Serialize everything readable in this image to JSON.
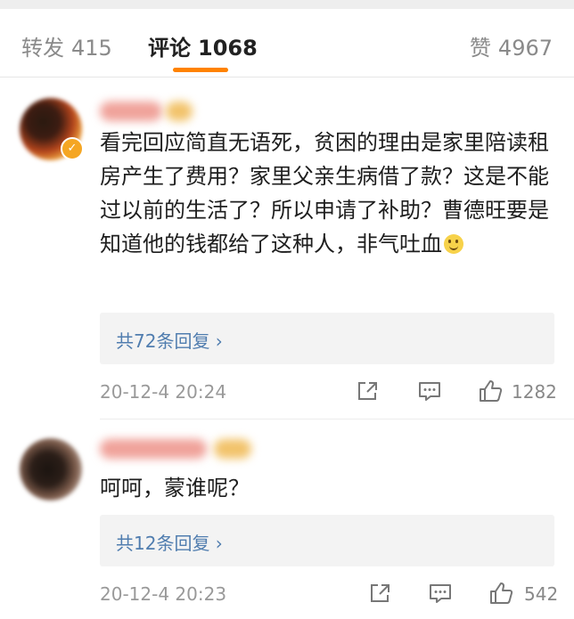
{
  "tabs": [
    {
      "label": "转发",
      "count": "415"
    },
    {
      "label": "评论",
      "count": "1068"
    },
    {
      "label": "赞",
      "count": "4967"
    }
  ],
  "comments": [
    {
      "text": "看完回应简直无语死，贫困的理由是家里陪读租房产生了费用？家里父亲生病借了款？这是不能过以前的生活了？所以申请了补助？曹德旺要是知道他的钱都给了这种人，非气吐血",
      "replies": "共72条回复 ›",
      "time": "20-12-4 20:24",
      "likes": "1282"
    },
    {
      "text": "呵呵，蒙谁呢？",
      "replies": "共12条回复 ›",
      "time": "20-12-4 20:23",
      "likes": "542"
    }
  ],
  "icons": {
    "share": "share-icon",
    "comment": "comment-icon",
    "like": "thumbs-up-icon"
  },
  "colors": {
    "accent": "#ff8200",
    "link": "#507daf"
  }
}
